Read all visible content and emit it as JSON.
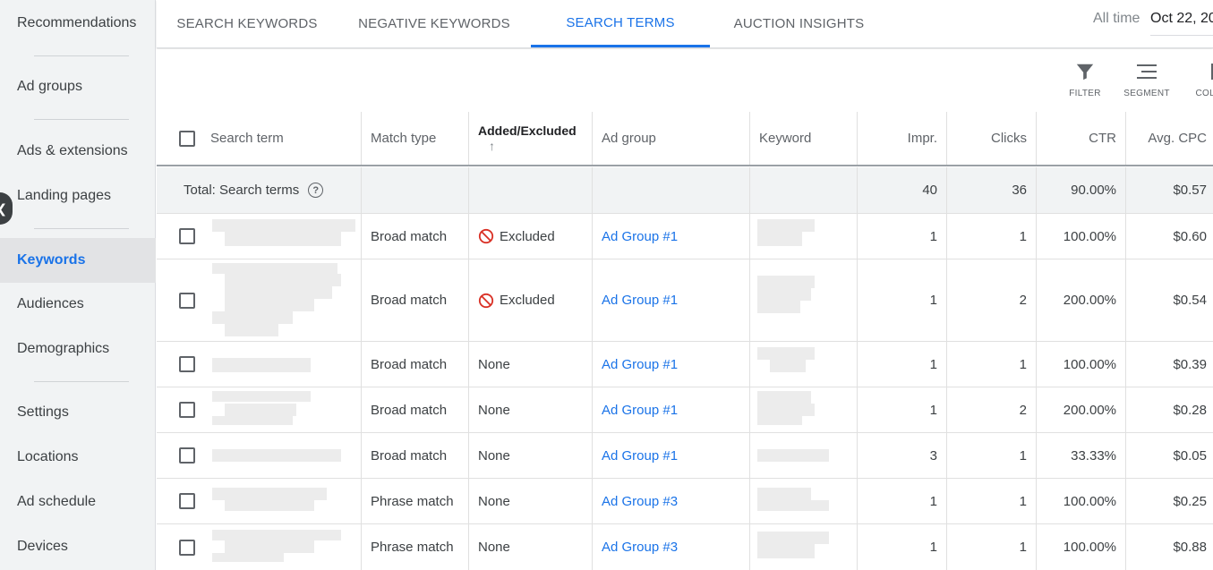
{
  "sidebar": {
    "items": [
      {
        "label": "Recommendations",
        "active": false
      },
      {
        "label": "Ad groups",
        "active": false
      },
      {
        "label": "Ads & extensions",
        "active": false
      },
      {
        "label": "Landing pages",
        "active": false
      },
      {
        "label": "Keywords",
        "active": true
      },
      {
        "label": "Audiences",
        "active": false
      },
      {
        "label": "Demographics",
        "active": false
      },
      {
        "label": "Settings",
        "active": false
      },
      {
        "label": "Locations",
        "active": false
      },
      {
        "label": "Ad schedule",
        "active": false
      },
      {
        "label": "Devices",
        "active": false
      }
    ],
    "collapse_glyph": "❮"
  },
  "tabs": [
    {
      "label": "SEARCH KEYWORDS",
      "active": false
    },
    {
      "label": "NEGATIVE KEYWORDS",
      "active": false
    },
    {
      "label": "SEARCH TERMS",
      "active": true
    },
    {
      "label": "AUCTION INSIGHTS",
      "active": false
    }
  ],
  "date_range": {
    "label": "All time",
    "value": "Oct 22, 20"
  },
  "toolbar": {
    "filter_label": "FILTER",
    "segment_label": "SEGMENT",
    "columns_label": "COLU"
  },
  "table": {
    "headers": {
      "search_term": "Search term",
      "match_type": "Match type",
      "added_excluded": "Added/Excluded",
      "sort_glyph": "↑",
      "ad_group": "Ad group",
      "keyword": "Keyword",
      "impr": "Impr.",
      "clicks": "Clicks",
      "ctr": "CTR",
      "avg_cpc": "Avg. CPC"
    },
    "total": {
      "label": "Total: Search terms",
      "help_glyph": "?",
      "impr": "40",
      "clicks": "36",
      "ctr": "90.00%",
      "avg_cpc": "$0.57"
    },
    "rows": [
      {
        "match_type": "Broad match",
        "status": "Excluded",
        "excluded": true,
        "ad_group": "Ad Group #1",
        "impr": "1",
        "clicks": "1",
        "ctr": "100.00%",
        "avg_cpc": "$0.60"
      },
      {
        "match_type": "Broad match",
        "status": "Excluded",
        "excluded": true,
        "ad_group": "Ad Group #1",
        "impr": "1",
        "clicks": "2",
        "ctr": "200.00%",
        "avg_cpc": "$0.54"
      },
      {
        "match_type": "Broad match",
        "status": "None",
        "excluded": false,
        "ad_group": "Ad Group #1",
        "impr": "1",
        "clicks": "1",
        "ctr": "100.00%",
        "avg_cpc": "$0.39"
      },
      {
        "match_type": "Broad match",
        "status": "None",
        "excluded": false,
        "ad_group": "Ad Group #1",
        "impr": "1",
        "clicks": "2",
        "ctr": "200.00%",
        "avg_cpc": "$0.28"
      },
      {
        "match_type": "Broad match",
        "status": "None",
        "excluded": false,
        "ad_group": "Ad Group #1",
        "impr": "3",
        "clicks": "1",
        "ctr": "33.33%",
        "avg_cpc": "$0.05"
      },
      {
        "match_type": "Phrase match",
        "status": "None",
        "excluded": false,
        "ad_group": "Ad Group #3",
        "impr": "1",
        "clicks": "1",
        "ctr": "100.00%",
        "avg_cpc": "$0.25"
      },
      {
        "match_type": "Phrase match",
        "status": "None",
        "excluded": false,
        "ad_group": "Ad Group #3",
        "impr": "1",
        "clicks": "1",
        "ctr": "100.00%",
        "avg_cpc": "$0.88"
      }
    ]
  },
  "colors": {
    "accent": "#1a73e8",
    "excluded_icon": "#d93025",
    "sidebar_bg": "#f1f3f4"
  }
}
